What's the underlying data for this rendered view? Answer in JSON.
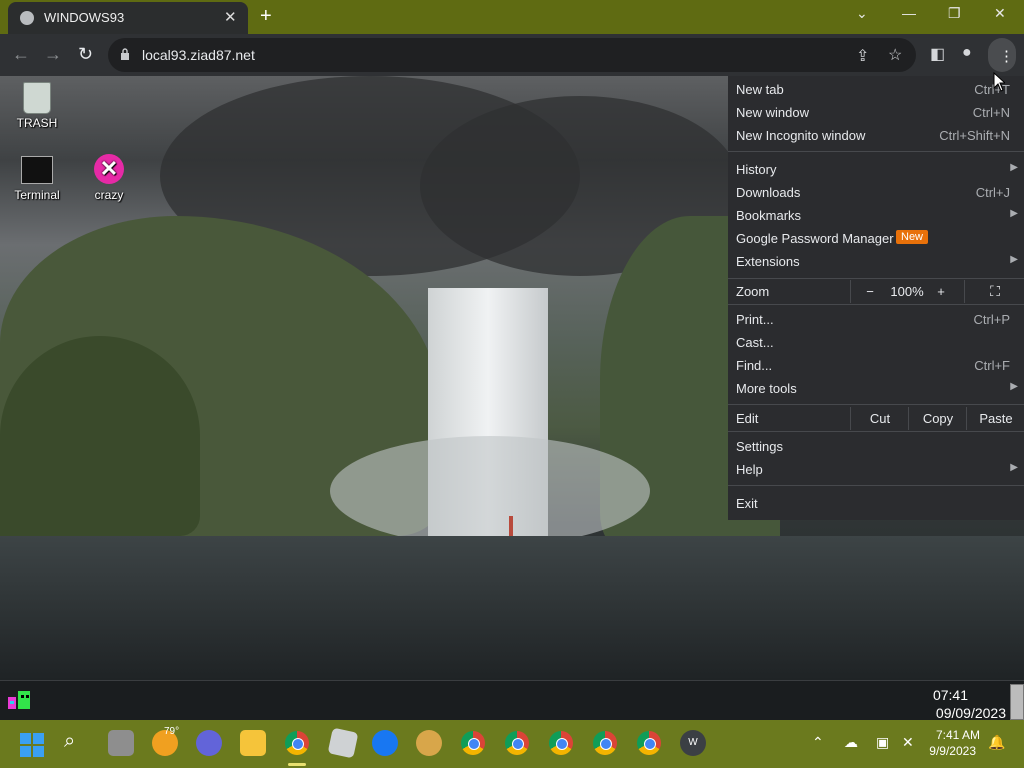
{
  "browser": {
    "tab_title": "WINDOWS93",
    "url": "local93.ziad87.net",
    "window_controls": [
      "chevron-down-icon",
      "minimize-icon",
      "restore-icon",
      "close-icon"
    ]
  },
  "desktop": {
    "icons": [
      {
        "label": "TRASH",
        "icon": "trash-icon"
      },
      {
        "label": "Terminal",
        "icon": "terminal-icon"
      },
      {
        "label": "crazy",
        "icon": "crazy-icon"
      }
    ]
  },
  "menu": {
    "new_tab": {
      "label": "New tab",
      "shortcut": "Ctrl+T"
    },
    "new_window": {
      "label": "New window",
      "shortcut": "Ctrl+N"
    },
    "incognito": {
      "label": "New Incognito window",
      "shortcut": "Ctrl+Shift+N"
    },
    "history": {
      "label": "History"
    },
    "downloads": {
      "label": "Downloads",
      "shortcut": "Ctrl+J"
    },
    "bookmarks": {
      "label": "Bookmarks"
    },
    "password_manager": {
      "label": "Google Password Manager",
      "badge": "New"
    },
    "extensions": {
      "label": "Extensions"
    },
    "zoom": {
      "label": "Zoom",
      "minus": "−",
      "value": "100%",
      "plus": "+"
    },
    "print": {
      "label": "Print...",
      "shortcut": "Ctrl+P"
    },
    "cast": {
      "label": "Cast..."
    },
    "find": {
      "label": "Find...",
      "shortcut": "Ctrl+F"
    },
    "more_tools": {
      "label": "More tools"
    },
    "edit": {
      "label": "Edit",
      "cut": "Cut",
      "copy": "Copy",
      "paste": "Paste"
    },
    "settings": {
      "label": "Settings"
    },
    "help": {
      "label": "Help"
    },
    "exit": {
      "label": "Exit"
    }
  },
  "w93_panel": {
    "time": "07:41",
    "date": "09/09/2023"
  },
  "taskbar": {
    "weather": "79°",
    "clock_time": "7:41 AM",
    "clock_date": "9/9/2023"
  },
  "colors": {
    "titlebar": "#5f6b12",
    "taskbar": "#6b7a1e",
    "menu_bg": "#2b2c2f",
    "badge": "#e8710a"
  }
}
